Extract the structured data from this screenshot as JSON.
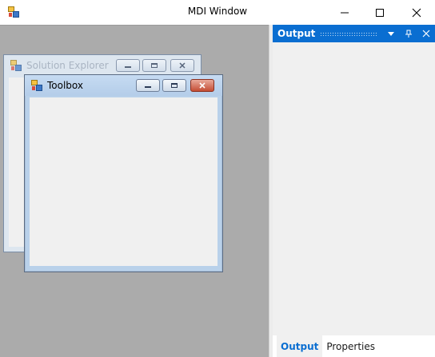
{
  "window": {
    "title": "MDI Window",
    "icon": "app-window-icon"
  },
  "mdi_children": [
    {
      "title": "Solution Explorer",
      "icon": "app-window-icon",
      "state": "inactive"
    },
    {
      "title": "Toolbox",
      "icon": "app-window-icon",
      "state": "active"
    }
  ],
  "dock_panel": {
    "title": "Output",
    "buttons": [
      "dropdown-icon",
      "pin-icon",
      "close-icon"
    ],
    "tabs": [
      {
        "label": "Output",
        "active": true
      },
      {
        "label": "Properties",
        "active": false
      }
    ]
  },
  "colors": {
    "accent": "#0a6ed1",
    "mdi_background": "#ababab",
    "panel_background": "#f0f0f0",
    "close_button": "#c44d34"
  }
}
